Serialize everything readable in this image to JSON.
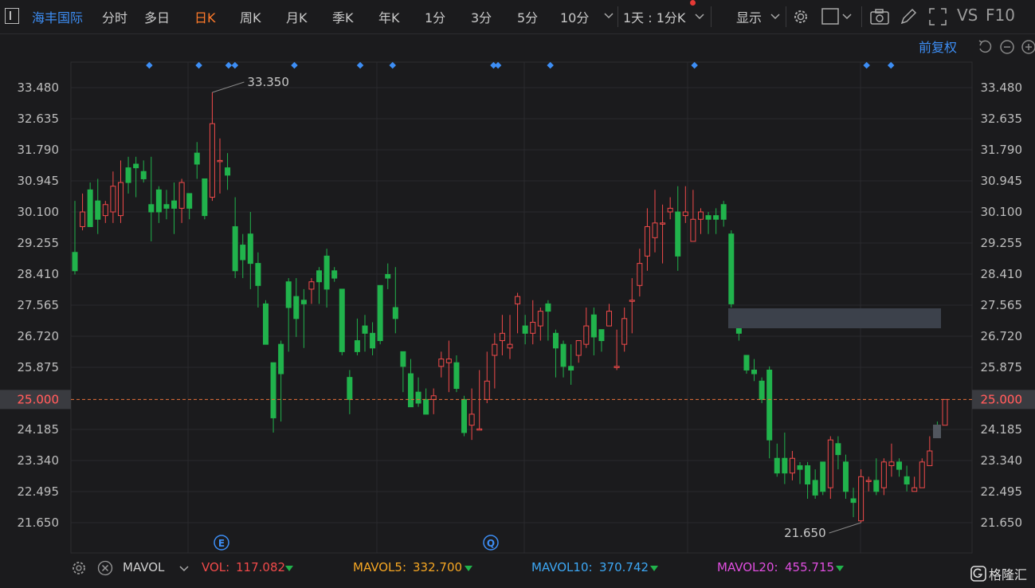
{
  "toolbar": {
    "panel_icon": "sidebar-toggle-icon",
    "stock_name": "海丰国际",
    "tabs": [
      "分时",
      "多日",
      "日K",
      "周K",
      "月K",
      "季K",
      "年K",
      "1分",
      "3分",
      "5分",
      "10分"
    ],
    "active_tab": "日K",
    "interval_select": "1天 : 1分K",
    "display_label": "显示",
    "vs_label": "VS",
    "f10_label": "F10"
  },
  "subbar": {
    "adjust_label": "前复权"
  },
  "chart_data": {
    "type": "candlestick",
    "y_ticks": [
      "33.480",
      "32.635",
      "31.790",
      "30.945",
      "30.100",
      "29.255",
      "28.410",
      "27.565",
      "26.720",
      "25.875",
      "25.000",
      "24.185",
      "23.340",
      "22.495",
      "21.650"
    ],
    "ylim": [
      21.65,
      33.48
    ],
    "current_price": "25.000",
    "annotations": {
      "high": "33.350",
      "low": "21.650"
    },
    "event_markers": [
      "E",
      "Q"
    ],
    "up_color": "#f04a4a",
    "down_color": "#21b34c",
    "candles": [
      [
        29.0,
        28.5,
        30.4,
        28.4
      ],
      [
        29.7,
        30.1,
        30.6,
        29.6
      ],
      [
        30.7,
        29.7,
        30.9,
        29.7
      ],
      [
        30.4,
        29.9,
        31.0,
        29.5
      ],
      [
        30.0,
        30.3,
        30.4,
        29.8
      ],
      [
        30.1,
        30.8,
        31.2,
        29.8
      ],
      [
        30.0,
        30.9,
        31.5,
        29.8
      ],
      [
        31.3,
        30.9,
        31.6,
        30.6
      ],
      [
        31.4,
        31.3,
        31.6,
        30.5
      ],
      [
        31.2,
        31.0,
        31.5,
        30.9
      ],
      [
        30.3,
        30.1,
        31.6,
        29.3
      ],
      [
        30.7,
        30.1,
        30.8,
        29.8
      ],
      [
        30.3,
        30.2,
        30.7,
        29.9
      ],
      [
        30.4,
        30.2,
        30.9,
        29.5
      ],
      [
        30.2,
        30.9,
        31.0,
        29.8
      ],
      [
        30.6,
        30.2,
        30.6,
        29.9
      ],
      [
        31.7,
        31.4,
        32.0,
        31.0
      ],
      [
        31.0,
        30.0,
        31.0,
        29.9
      ],
      [
        30.5,
        32.5,
        33.35,
        30.4
      ],
      [
        31.5,
        31.5,
        32.1,
        30.6
      ],
      [
        31.3,
        31.1,
        31.7,
        30.7
      ],
      [
        29.7,
        28.5,
        30.5,
        28.3
      ],
      [
        29.2,
        28.8,
        29.5,
        28.3
      ],
      [
        29.5,
        28.7,
        30.1,
        28.0
      ],
      [
        28.7,
        28.1,
        29.0,
        27.5
      ],
      [
        27.6,
        26.5,
        27.7,
        26.5
      ],
      [
        26.0,
        24.5,
        26.0,
        24.1
      ],
      [
        26.5,
        25.7,
        26.6,
        24.4
      ],
      [
        28.2,
        27.5,
        28.3,
        26.3
      ],
      [
        27.8,
        27.2,
        28.3,
        26.7
      ],
      [
        27.7,
        27.6,
        28.0,
        26.4
      ],
      [
        28.0,
        28.2,
        28.3,
        27.6
      ],
      [
        28.5,
        28.2,
        28.6,
        27.6
      ],
      [
        28.9,
        28.0,
        29.1,
        27.5
      ],
      [
        28.5,
        28.3,
        28.6,
        28.2
      ],
      [
        28.0,
        26.3,
        28.0,
        26.2
      ],
      [
        25.6,
        25.0,
        25.8,
        24.6
      ],
      [
        26.6,
        26.3,
        27.2,
        26.2
      ],
      [
        27.0,
        26.8,
        27.3,
        26.3
      ],
      [
        26.8,
        26.4,
        27.1,
        26.2
      ],
      [
        28.1,
        26.6,
        28.1,
        26.5
      ],
      [
        28.4,
        28.3,
        28.7,
        28.0
      ],
      [
        27.5,
        27.2,
        28.6,
        26.8
      ],
      [
        26.3,
        25.9,
        26.3,
        25.2
      ],
      [
        25.7,
        24.8,
        26.1,
        24.8
      ],
      [
        25.2,
        24.9,
        25.6,
        24.8
      ],
      [
        25.0,
        24.6,
        25.3,
        24.6
      ],
      [
        25.0,
        25.1,
        25.3,
        24.6
      ],
      [
        25.9,
        26.1,
        26.3,
        25.6
      ],
      [
        26.0,
        26.1,
        26.6,
        25.2
      ],
      [
        26.0,
        25.3,
        26.2,
        25.2
      ],
      [
        25.0,
        24.1,
        25.1,
        24.0
      ],
      [
        24.3,
        24.6,
        25.3,
        23.9
      ],
      [
        24.2,
        24.2,
        25.8,
        24.2
      ],
      [
        25.0,
        25.5,
        26.3,
        24.9
      ],
      [
        26.2,
        26.5,
        26.8,
        25.3
      ],
      [
        26.6,
        26.8,
        27.3,
        26.2
      ],
      [
        26.4,
        26.5,
        27.3,
        26.1
      ],
      [
        27.6,
        27.8,
        27.9,
        26.8
      ],
      [
        27.0,
        26.8,
        27.3,
        26.5
      ],
      [
        26.8,
        27.1,
        27.7,
        26.5
      ],
      [
        27.0,
        27.4,
        27.5,
        26.6
      ],
      [
        27.6,
        27.4,
        27.7,
        26.6
      ],
      [
        26.8,
        26.4,
        26.9,
        25.6
      ],
      [
        26.5,
        25.9,
        26.6,
        25.6
      ],
      [
        25.9,
        25.8,
        26.5,
        25.4
      ],
      [
        26.2,
        26.6,
        26.6,
        26.0
      ],
      [
        26.5,
        27.0,
        27.5,
        26.4
      ],
      [
        27.3,
        26.7,
        27.5,
        26.2
      ],
      [
        26.9,
        26.6,
        26.9,
        26.3
      ],
      [
        27.0,
        27.4,
        27.6,
        27.0
      ],
      [
        25.9,
        25.9,
        26.9,
        25.8
      ],
      [
        26.5,
        27.2,
        27.5,
        26.3
      ],
      [
        27.7,
        27.7,
        28.3,
        26.8
      ],
      [
        28.1,
        28.7,
        29.1,
        27.8
      ],
      [
        28.9,
        29.7,
        30.2,
        28.5
      ],
      [
        29.4,
        29.8,
        30.7,
        29.0
      ],
      [
        29.8,
        29.8,
        30.3,
        28.7
      ],
      [
        30.1,
        30.2,
        30.5,
        29.9
      ],
      [
        30.1,
        28.9,
        30.8,
        28.5
      ],
      [
        30.0,
        30.1,
        30.8,
        29.8
      ],
      [
        29.3,
        29.9,
        30.7,
        29.3
      ],
      [
        29.9,
        30.1,
        30.2,
        29.5
      ],
      [
        30.0,
        29.9,
        30.1,
        29.5
      ],
      [
        30.0,
        29.9,
        30.2,
        29.5
      ],
      [
        30.3,
        29.9,
        30.4,
        29.7
      ],
      [
        29.5,
        27.6,
        29.6,
        27.5
      ],
      [
        27.3,
        26.8,
        27.4,
        26.6
      ],
      [
        26.2,
        25.8,
        26.2,
        25.7
      ],
      [
        25.8,
        25.7,
        26.1,
        25.5
      ],
      [
        25.5,
        25.0,
        25.6,
        24.9
      ],
      [
        25.8,
        23.9,
        25.9,
        23.4
      ],
      [
        23.4,
        23.0,
        23.8,
        22.9
      ],
      [
        23.4,
        23.0,
        24.1,
        22.7
      ],
      [
        23.0,
        23.4,
        23.6,
        22.8
      ],
      [
        23.2,
        23.1,
        23.3,
        22.7
      ],
      [
        23.2,
        22.7,
        23.3,
        22.3
      ],
      [
        22.8,
        22.4,
        23.1,
        22.3
      ],
      [
        23.3,
        22.5,
        23.3,
        22.4
      ],
      [
        22.6,
        23.9,
        24.0,
        22.3
      ],
      [
        23.8,
        23.5,
        24.0,
        23.1
      ],
      [
        23.3,
        22.5,
        23.5,
        22.3
      ],
      [
        22.3,
        22.2,
        22.6,
        21.8
      ],
      [
        21.7,
        22.9,
        23.1,
        21.65
      ],
      [
        22.8,
        22.8,
        22.9,
        22.5
      ],
      [
        22.8,
        22.5,
        23.4,
        22.4
      ],
      [
        22.6,
        23.3,
        23.4,
        22.4
      ],
      [
        23.2,
        23.3,
        23.8,
        22.9
      ],
      [
        23.3,
        23.1,
        23.4,
        22.9
      ],
      [
        22.9,
        22.7,
        23.2,
        22.5
      ],
      [
        22.5,
        22.6,
        22.9,
        22.5
      ],
      [
        22.6,
        23.3,
        23.4,
        22.6
      ],
      [
        23.2,
        23.6,
        24.0,
        23.2
      ],
      [
        24.3,
        24.0,
        24.4,
        24.0
      ],
      [
        24.3,
        25.0,
        25.0,
        24.3
      ]
    ]
  },
  "volume_bar": {
    "settings_icon": "gear-icon",
    "close_icon": "close-icon",
    "indicator": "MAVOL",
    "vol_label": "VOL:",
    "vol_value": "117.082",
    "mavol5_label": "MAVOL5:",
    "mavol5_value": "332.700",
    "mavol10_label": "MAVOL10:",
    "mavol10_value": "370.742",
    "mavol20_label": "MAVOL20:",
    "mavol20_value": "455.715",
    "colors": {
      "vol": "#f04a4a",
      "mavol5": "#f5a623",
      "mavol10": "#3da8f5",
      "mavol20": "#e04ee0"
    }
  },
  "brand": {
    "name": "格隆汇"
  }
}
